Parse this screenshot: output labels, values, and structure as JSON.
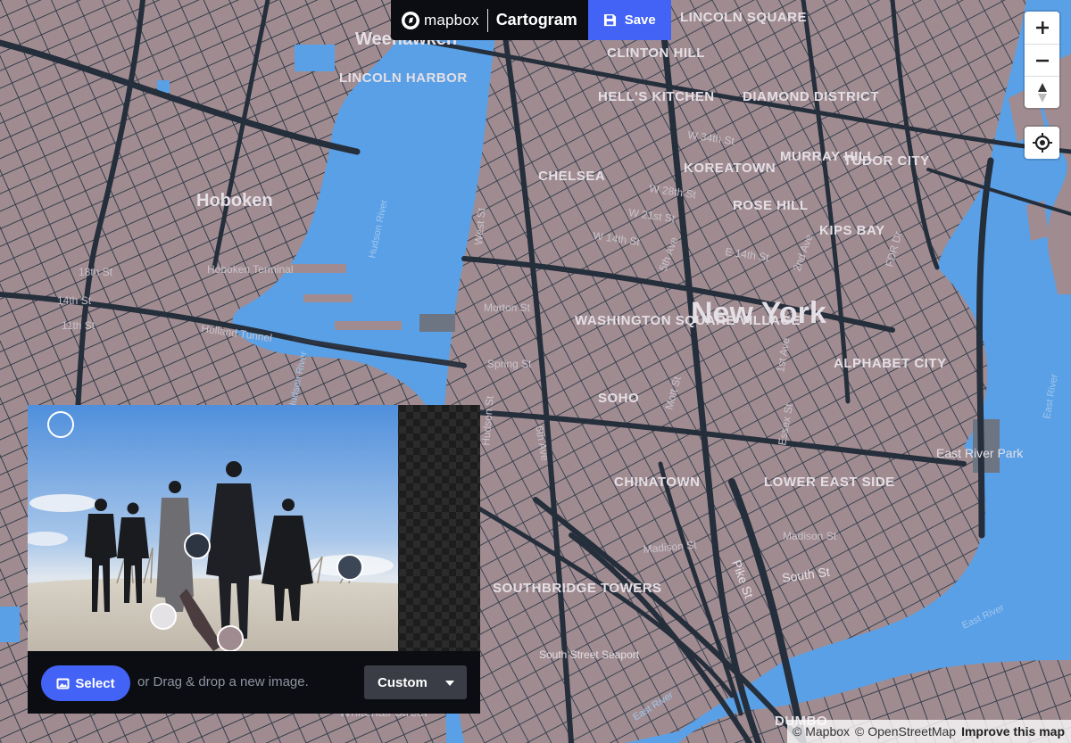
{
  "app": {
    "brand": "mapbox",
    "product": "Cartogram",
    "save_label": "Save"
  },
  "map_controls": {
    "zoom_in": "+",
    "zoom_out": "−"
  },
  "map_labels": {
    "city": "New York",
    "town": "Hoboken",
    "districts": [
      "LINCOLN HARBOR",
      "CLINTON HILL",
      "HELL'S KITCHEN",
      "DIAMOND DISTRICT",
      "CHELSEA",
      "KOREATOWN",
      "MURRAY HILL",
      "TUDOR CITY",
      "ROSE HILL",
      "KIPS BAY",
      "WASHINGTON SQUARE VILLAGE",
      "ALPHABET CITY",
      "SOHO",
      "CHINATOWN",
      "LOWER EAST SIDE",
      "SOUTHBRIDGE TOWERS",
      "DUMBO",
      "LINCOLN SQUARE"
    ],
    "places": [
      "Weehawken",
      "Hoboken Terminal",
      "East River Park",
      "South Street Seaport",
      "Holland Tunnel"
    ],
    "streets": [
      "14th St",
      "11th St",
      "18th St",
      "W 14th St",
      "E 14th St",
      "W 28th St",
      "W 21st St",
      "W 34th St",
      "Spring St",
      "Morton St",
      "Madison St",
      "Pike St",
      "South St",
      "Essex St",
      "1st Ave",
      "2nd Ave",
      "5th Ave",
      "6th Ave",
      "9th Ave",
      "FDR Dr",
      "West St",
      "Hudson St",
      "Mott St",
      "Bowery",
      "Whitehall Street"
    ],
    "water": [
      "Hudson River",
      "East River"
    ]
  },
  "image_panel": {
    "select_label": "Select",
    "drop_hint": "or Drag & drop a new image.",
    "palette_mode": "Custom"
  },
  "palette": {
    "water": "#5aa0e6",
    "land": "#a08c90",
    "roads": "#26303f",
    "labels": "#e4dfe5",
    "accent": "#4263f5"
  },
  "swatches": [
    {
      "name": "water",
      "color": "#5aa0e6"
    },
    {
      "name": "roads-dark",
      "color": "#2c3541"
    },
    {
      "name": "roads-slate",
      "color": "#3b4756"
    },
    {
      "name": "labels-light",
      "color": "#e4e2e4"
    },
    {
      "name": "land-mauve",
      "color": "#a08c90"
    }
  ],
  "attribution": {
    "mapbox": "© Mapbox",
    "osm": "© OpenStreetMap",
    "improve": "Improve this map"
  }
}
